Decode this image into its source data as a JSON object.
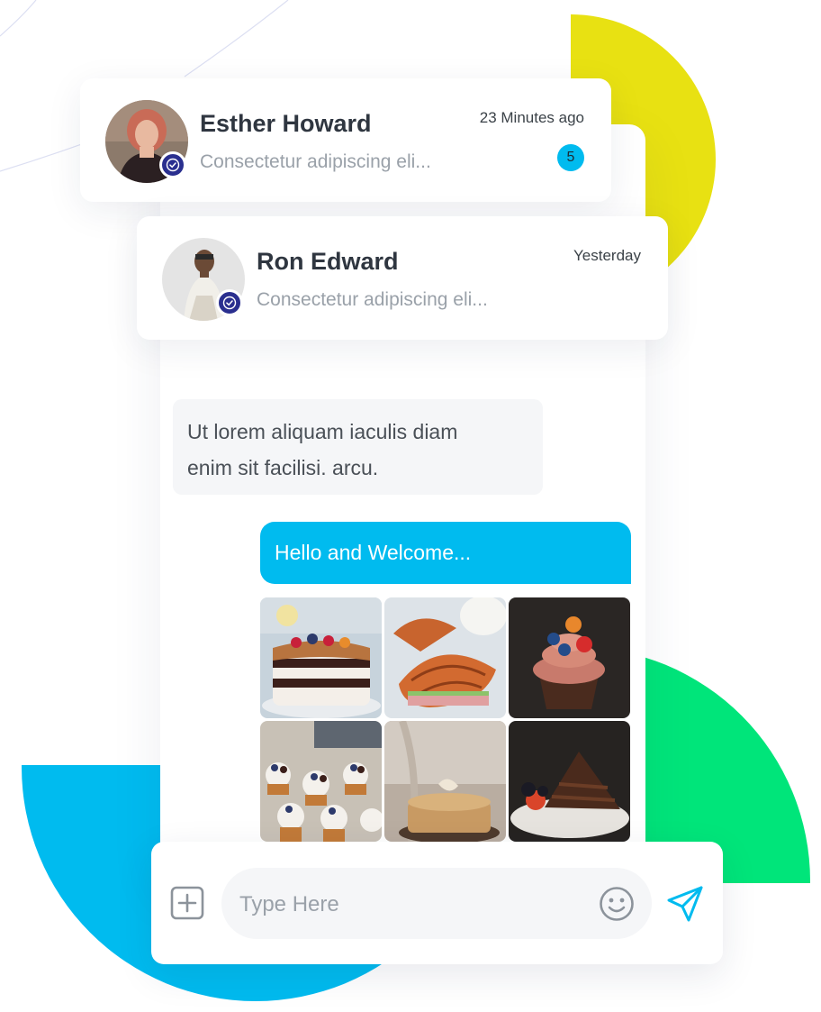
{
  "colors": {
    "accent_blue": "#00bbef",
    "yellow": "#e8e112",
    "green": "#00e57a",
    "verified_badge": "#2a2f8f",
    "text_dark": "#2f3640",
    "text_muted": "#9aa1a9",
    "bubble_in": "#f5f6f8"
  },
  "chat_list": [
    {
      "name": "Esther Howard",
      "preview": "Consectetur adipiscing eli...",
      "time": "23 Minutes ago",
      "unread": "5",
      "verified": true,
      "avatar_icon": "person-avatar"
    },
    {
      "name": "Ron Edward",
      "preview": "Consectetur adipiscing eli...",
      "time": "Yesterday",
      "verified": true,
      "avatar_icon": "person-avatar"
    }
  ],
  "conversation": {
    "incoming": {
      "line1": "Ut lorem aliquam iaculis diam",
      "line2": "enim sit facilisi. arcu."
    },
    "outgoing": "Hello and Welcome...",
    "photos": [
      "layer-cake",
      "croissant",
      "cupcake",
      "cupcakes",
      "tart",
      "chocolate-cake-slice"
    ]
  },
  "composer": {
    "placeholder": "Type Here",
    "attach_icon": "plus-square-icon",
    "emoji_icon": "smiley-icon",
    "send_icon": "send-icon"
  }
}
